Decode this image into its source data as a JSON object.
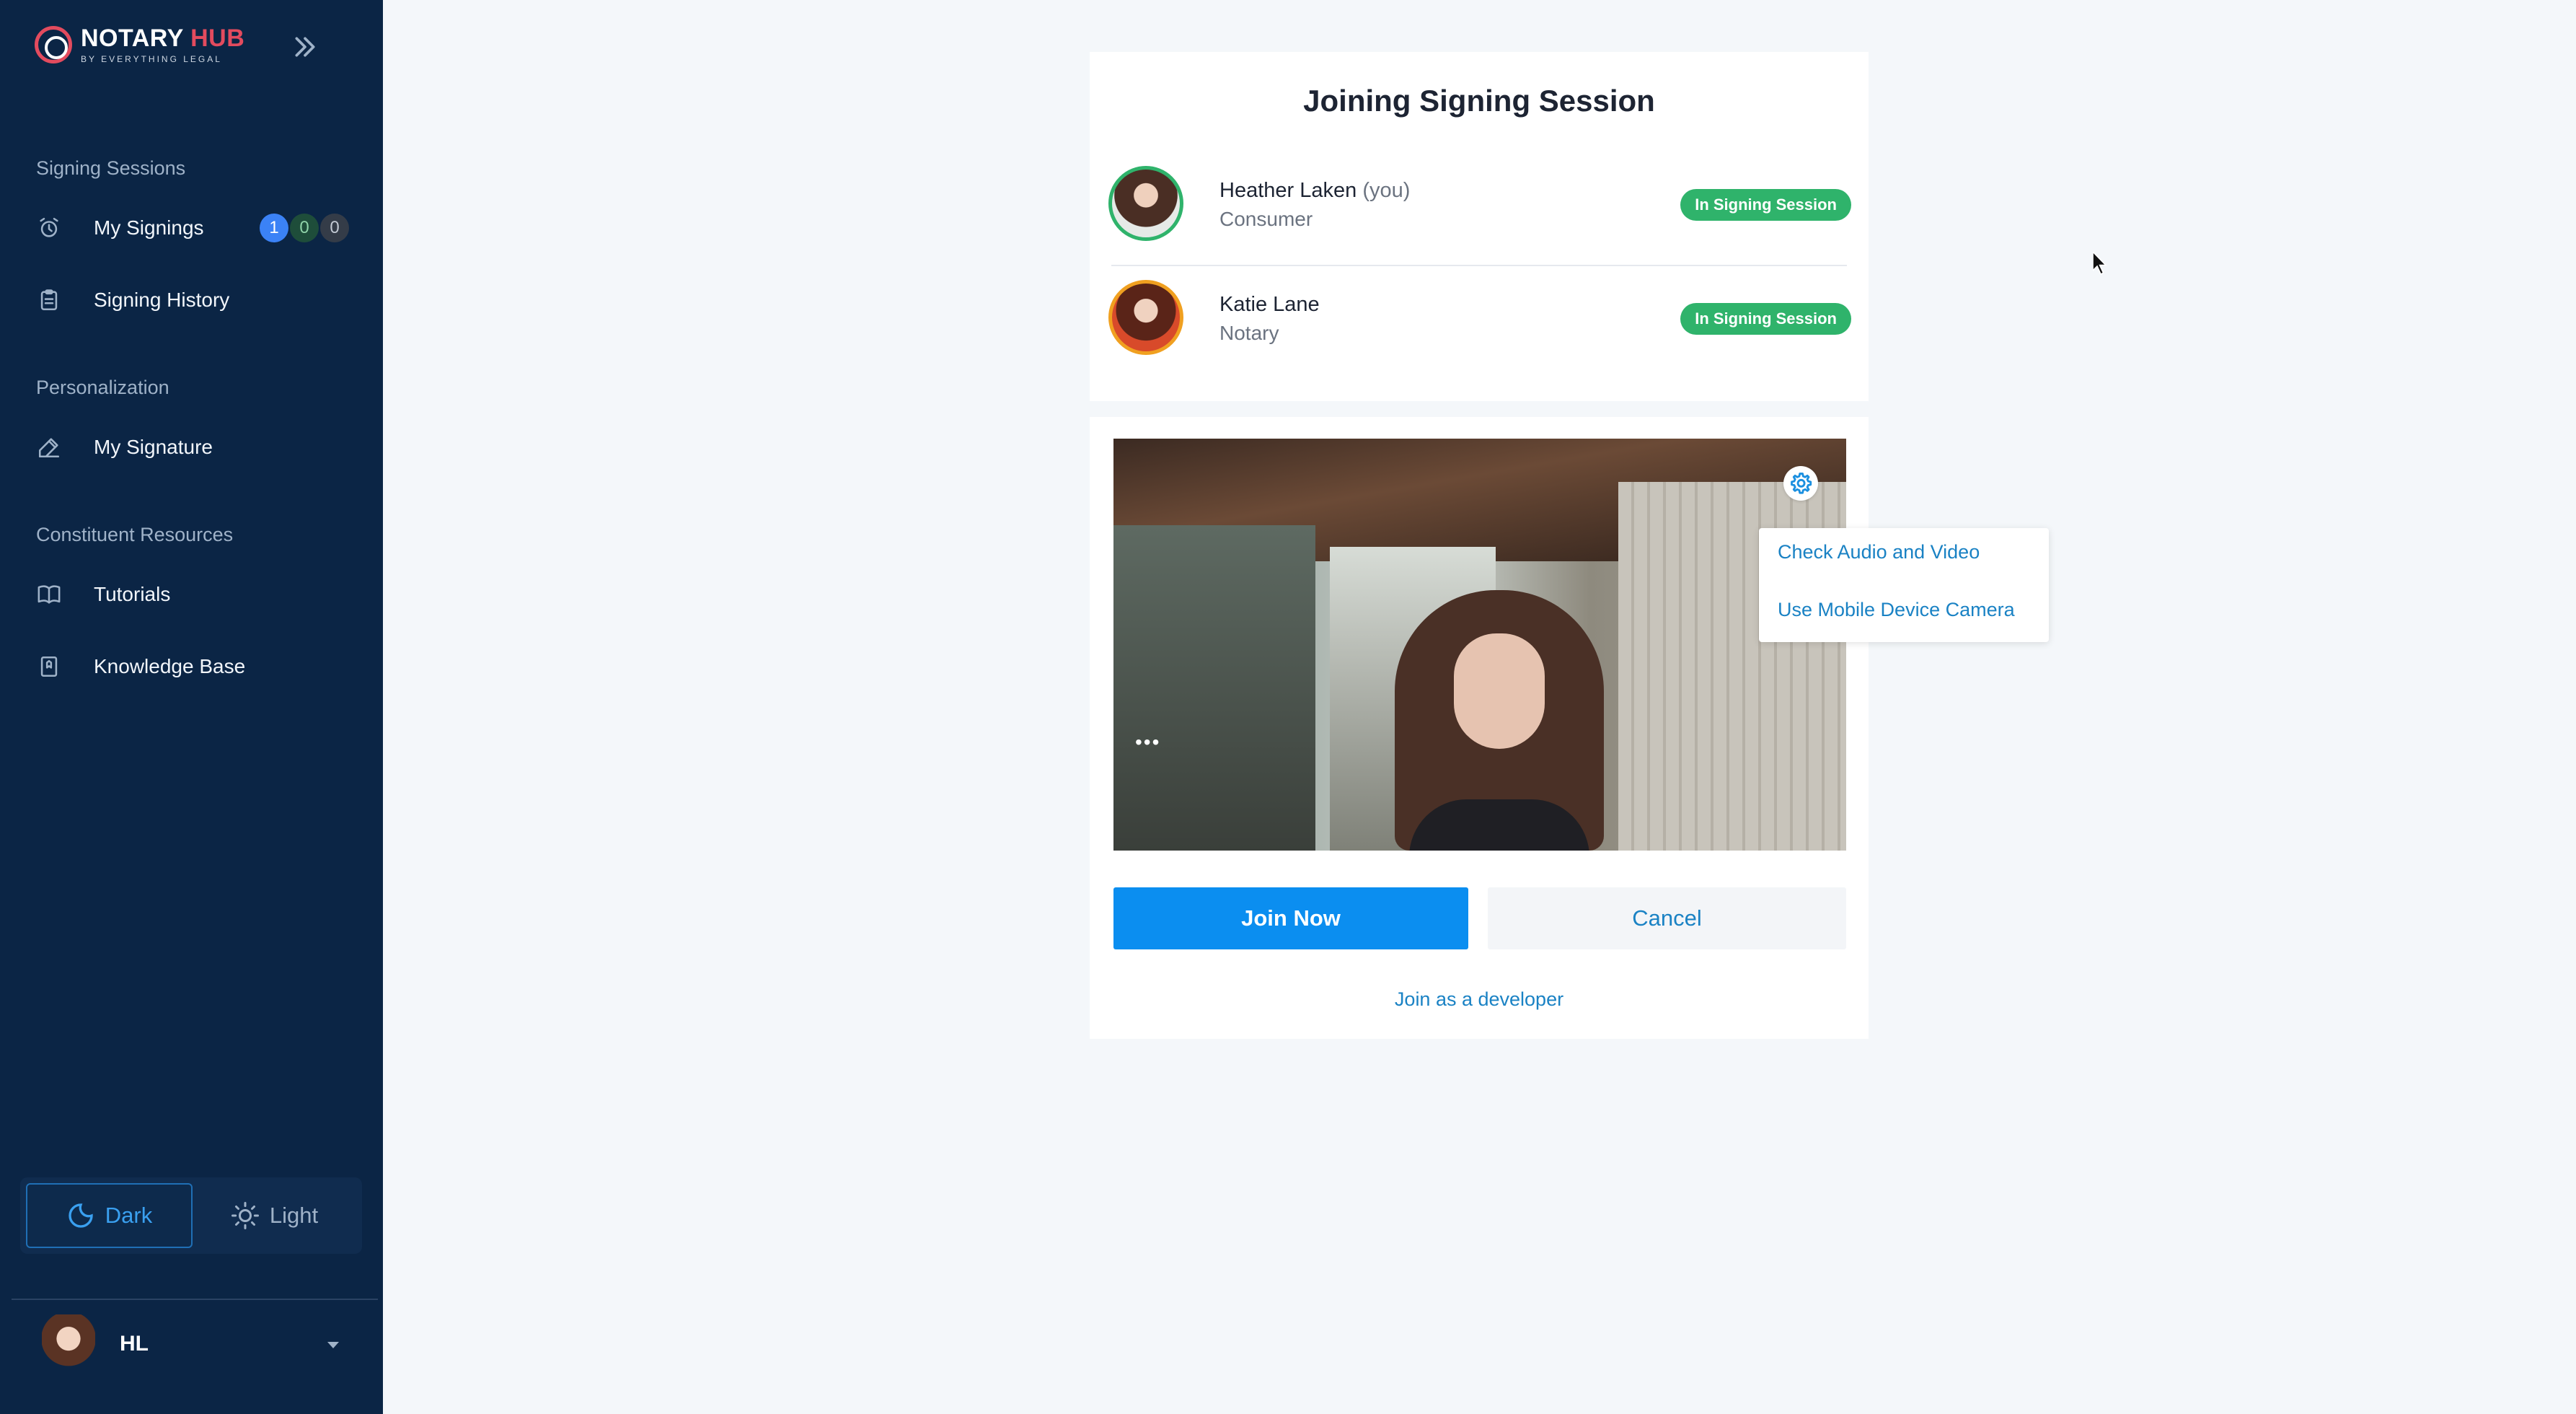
{
  "app": {
    "brand_main": "NOTARY",
    "brand_accent": "HUB",
    "brand_sub": "BY EVERYTHING LEGAL"
  },
  "sidebar": {
    "sections": [
      {
        "title": "Signing Sessions",
        "items": [
          {
            "label": "My Signings",
            "icon": "alarm-clock-icon",
            "badges": [
              "1",
              "0",
              "0"
            ]
          },
          {
            "label": "Signing History",
            "icon": "clipboard-icon"
          }
        ]
      },
      {
        "title": "Personalization",
        "items": [
          {
            "label": "My Signature",
            "icon": "pen-icon"
          }
        ]
      },
      {
        "title": "Constituent Resources",
        "items": [
          {
            "label": "Tutorials",
            "icon": "book-icon"
          },
          {
            "label": "Knowledge Base",
            "icon": "bookmark-icon"
          }
        ]
      }
    ],
    "theme": {
      "dark_label": "Dark",
      "light_label": "Light",
      "selected": "Dark"
    },
    "user": {
      "initials": "HL"
    }
  },
  "session": {
    "title": "Joining Signing Session",
    "participants": [
      {
        "name": "Heather Laken",
        "suffix": "(you)",
        "role": "Consumer",
        "status": "In Signing Session"
      },
      {
        "name": "Katie Lane",
        "suffix": "",
        "role": "Notary",
        "status": "In Signing Session"
      }
    ],
    "video_overlay": "•••",
    "settings_menu": [
      "Check Audio and Video",
      "Use Mobile Device Camera"
    ],
    "join_label": "Join Now",
    "cancel_label": "Cancel",
    "developer_link": "Join as a developer"
  },
  "colors": {
    "sidebar_bg": "#0b2545",
    "accent": "#0b8ef0",
    "status_green": "#2fb36b",
    "brand_red": "#e34b5e",
    "link_blue": "#1a82c4"
  }
}
